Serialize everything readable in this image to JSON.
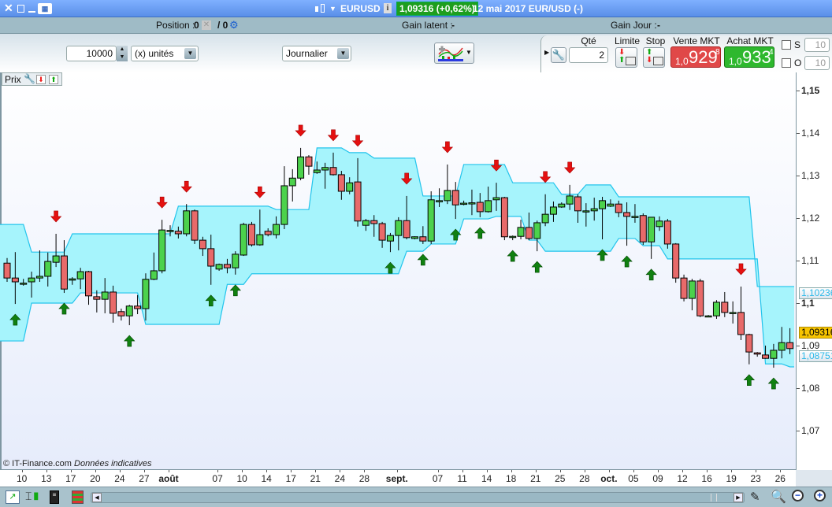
{
  "titlebar": {
    "symbol": "EURUSD",
    "price_badge": "1,09316 (+0,62%)",
    "date_info": "12 mai 2017 EUR/USD (-)",
    "badge_color": "#1e9e1e"
  },
  "infobar": {
    "position_label": "Position :",
    "position_value": "0",
    "position_slash": "/ 0",
    "gain_latent_label": "Gain latent :",
    "gain_latent_value": "-",
    "gain_jour_label": "Gain Jour :",
    "gain_jour_value": "-"
  },
  "toolbar": {
    "quantity": "10000",
    "unit": "(x) unités",
    "period": "Journalier"
  },
  "order_panel": {
    "qty_label": "Qté",
    "qty_value": "2",
    "limit_label": "Limite",
    "stop_label": "Stop",
    "sell_label": "Vente MKT",
    "sell_prefix": "1,0",
    "sell_big": "929",
    "sell_sup": "8",
    "buy_label": "Achat MKT",
    "buy_prefix": "1,0",
    "buy_big": "933",
    "buy_sup": "4",
    "s_label": "S",
    "s_value": "10",
    "o_label": "O",
    "o_value": "10",
    "sell_color": "#e04848",
    "buy_color": "#2eb82e"
  },
  "chart_header": {
    "label": "Prix"
  },
  "watermark": {
    "brand": "© IT-Finance.com",
    "note": "Données indicatives"
  },
  "chart_data": {
    "type": "candlestick",
    "ylim": [
      1.07,
      1.15
    ],
    "y_ticks": [
      {
        "v": 1.15,
        "label": "1,15",
        "bold": true
      },
      {
        "v": 1.14,
        "label": "1,14"
      },
      {
        "v": 1.13,
        "label": "1,13"
      },
      {
        "v": 1.12,
        "label": "1,12"
      },
      {
        "v": 1.11,
        "label": "1,11"
      },
      {
        "v": 1.1,
        "label": "1,1",
        "bold": true
      },
      {
        "v": 1.09,
        "label": "1,09"
      },
      {
        "v": 1.08,
        "label": "1,08"
      },
      {
        "v": 1.07,
        "label": "1,07"
      }
    ],
    "x_ticks": [
      "10",
      "13",
      "17",
      "20",
      "24",
      "27",
      "août",
      "07",
      "10",
      "14",
      "17",
      "21",
      "24",
      "28",
      "sept.",
      "07",
      "11",
      "14",
      "18",
      "21",
      "25",
      "28",
      "oct.",
      "05",
      "09",
      "12",
      "16",
      "19",
      "23",
      "26"
    ],
    "price_tags": [
      {
        "v": 1.10236,
        "label": "1,10236",
        "kind": "band"
      },
      {
        "v": 1.09316,
        "label": "1,09316",
        "kind": "last"
      },
      {
        "v": 1.08751,
        "label": "1,08751",
        "kind": "band"
      }
    ],
    "colors": {
      "up": "#4cd24c",
      "down": "#e86a6a",
      "band_fill": "#a6f4fc",
      "band_line": "#22c4ec",
      "sell_arrow": "#e41010",
      "buy_arrow": "#108010"
    },
    "ohlc": [
      [
        1.1094,
        1.1106,
        1.105,
        1.1059
      ],
      [
        1.1059,
        1.112,
        1.0998,
        1.105
      ],
      [
        1.1046,
        1.1057,
        1.1041,
        1.1047
      ],
      [
        1.105,
        1.1074,
        1.1013,
        1.1059
      ],
      [
        1.1059,
        1.1124,
        1.105,
        1.1063
      ],
      [
        1.1063,
        1.1119,
        1.1039,
        1.1098
      ],
      [
        1.1096,
        1.1163,
        1.1085,
        1.1111
      ],
      [
        1.1111,
        1.1148,
        1.1024,
        1.1033
      ],
      [
        1.1054,
        1.1061,
        1.1043,
        1.1057
      ],
      [
        1.1057,
        1.1083,
        1.1033,
        1.1074
      ],
      [
        1.1074,
        1.1076,
        1.0996,
        1.1017
      ],
      [
        1.1015,
        1.103,
        1.0978,
        1.1009
      ],
      [
        1.1009,
        1.1059,
        1.0976,
        1.1026
      ],
      [
        1.1026,
        1.1041,
        1.0954,
        1.0976
      ],
      [
        1.098,
        1.0987,
        1.0959,
        1.097
      ],
      [
        1.097,
        1.0996,
        1.0948,
        1.0993
      ],
      [
        1.0993,
        1.1019,
        1.0974,
        1.0987
      ],
      [
        1.0987,
        1.107,
        1.0959,
        1.1056
      ],
      [
        1.1056,
        1.1119,
        1.1054,
        1.1076
      ],
      [
        1.1076,
        1.1196,
        1.107,
        1.1172
      ],
      [
        1.117,
        1.1183,
        1.1157,
        1.1171
      ],
      [
        1.1169,
        1.118,
        1.1152,
        1.1163
      ],
      [
        1.1163,
        1.1233,
        1.1157,
        1.1217
      ],
      [
        1.1217,
        1.122,
        1.1139,
        1.1148
      ],
      [
        1.1148,
        1.1156,
        1.1111,
        1.1128
      ],
      [
        1.1128,
        1.1161,
        1.1043,
        1.1087
      ],
      [
        1.108,
        1.1093,
        1.1076,
        1.1091
      ],
      [
        1.1091,
        1.1104,
        1.107,
        1.1083
      ],
      [
        1.1083,
        1.1122,
        1.1067,
        1.1115
      ],
      [
        1.1113,
        1.1189,
        1.1111,
        1.1185
      ],
      [
        1.1185,
        1.1191,
        1.1133,
        1.1137
      ],
      [
        1.1137,
        1.122,
        1.1135,
        1.1161
      ],
      [
        1.1169,
        1.1176,
        1.1157,
        1.1161
      ],
      [
        1.1161,
        1.1204,
        1.1152,
        1.1185
      ],
      [
        1.1185,
        1.1322,
        1.1174,
        1.1276
      ],
      [
        1.1276,
        1.1315,
        1.1239,
        1.1294
      ],
      [
        1.1294,
        1.1365,
        1.1289,
        1.1344
      ],
      [
        1.1344,
        1.1348,
        1.1302,
        1.1322
      ],
      [
        1.1307,
        1.1333,
        1.1304,
        1.1313
      ],
      [
        1.1313,
        1.133,
        1.1269,
        1.1319
      ],
      [
        1.1319,
        1.1354,
        1.13,
        1.1302
      ],
      [
        1.1302,
        1.1311,
        1.1243,
        1.1263
      ],
      [
        1.1263,
        1.1296,
        1.1256,
        1.1283
      ],
      [
        1.1285,
        1.1341,
        1.118,
        1.1193
      ],
      [
        1.1183,
        1.1198,
        1.117,
        1.1194
      ],
      [
        1.1194,
        1.1207,
        1.1156,
        1.1187
      ],
      [
        1.1187,
        1.1191,
        1.113,
        1.1148
      ],
      [
        1.1146,
        1.1165,
        1.112,
        1.1159
      ],
      [
        1.1159,
        1.1202,
        1.1124,
        1.1194
      ],
      [
        1.1194,
        1.1252,
        1.115,
        1.1154
      ],
      [
        1.1152,
        1.1157,
        1.115,
        1.1156
      ],
      [
        1.1156,
        1.1181,
        1.1139,
        1.1146
      ],
      [
        1.1146,
        1.1263,
        1.1139,
        1.1243
      ],
      [
        1.1241,
        1.127,
        1.1226,
        1.1241
      ],
      [
        1.1241,
        1.1326,
        1.1233,
        1.1265
      ],
      [
        1.1265,
        1.1285,
        1.1198,
        1.1231
      ],
      [
        1.1235,
        1.1241,
        1.123,
        1.1235
      ],
      [
        1.1235,
        1.1267,
        1.1207,
        1.1236
      ],
      [
        1.1237,
        1.1259,
        1.1202,
        1.1215
      ],
      [
        1.1215,
        1.1274,
        1.1213,
        1.1241
      ],
      [
        1.1243,
        1.1283,
        1.1217,
        1.1248
      ],
      [
        1.1248,
        1.125,
        1.1148,
        1.1156
      ],
      [
        1.1157,
        1.1159,
        1.1148,
        1.1157
      ],
      [
        1.1157,
        1.1196,
        1.115,
        1.1178
      ],
      [
        1.1178,
        1.1213,
        1.1148,
        1.1152
      ],
      [
        1.1152,
        1.1194,
        1.1122,
        1.1189
      ],
      [
        1.1189,
        1.1256,
        1.1181,
        1.1209
      ],
      [
        1.1209,
        1.1239,
        1.1191,
        1.1226
      ],
      [
        1.1226,
        1.1237,
        1.1224,
        1.1233
      ],
      [
        1.1233,
        1.1278,
        1.1219,
        1.1252
      ],
      [
        1.125,
        1.1256,
        1.1189,
        1.1217
      ],
      [
        1.1217,
        1.1235,
        1.118,
        1.1217
      ],
      [
        1.1217,
        1.1248,
        1.1194,
        1.1222
      ],
      [
        1.1222,
        1.125,
        1.115,
        1.1241
      ],
      [
        1.1228,
        1.1244,
        1.1226,
        1.1233
      ],
      [
        1.1233,
        1.1241,
        1.1202,
        1.1213
      ],
      [
        1.1213,
        1.1237,
        1.1135,
        1.1204
      ],
      [
        1.1204,
        1.1233,
        1.1189,
        1.1204
      ],
      [
        1.1206,
        1.1211,
        1.1137,
        1.1144
      ],
      [
        1.1144,
        1.1202,
        1.1104,
        1.1202
      ],
      [
        1.118,
        1.1204,
        1.117,
        1.1193
      ],
      [
        1.1193,
        1.1198,
        1.1128,
        1.1139
      ],
      [
        1.1139,
        1.1141,
        1.1048,
        1.1059
      ],
      [
        1.1059,
        1.1067,
        1.1004,
        1.1011
      ],
      [
        1.1011,
        1.1057,
        1.0983,
        1.1052
      ],
      [
        1.1052,
        1.1057,
        1.0967,
        1.097
      ],
      [
        1.097,
        1.0972,
        1.0967,
        1.097
      ],
      [
        1.097,
        1.1007,
        1.0963,
        1.1002
      ],
      [
        1.1002,
        1.1026,
        1.0967,
        1.0978
      ],
      [
        1.0978,
        1.1004,
        1.0952,
        1.0978
      ],
      [
        1.0978,
        1.1039,
        1.0913,
        1.0926
      ],
      [
        1.0926,
        1.0928,
        1.0856,
        1.0885
      ],
      [
        1.0883,
        1.0885,
        1.0874,
        1.088
      ],
      [
        1.0878,
        1.09,
        1.0869,
        1.087
      ],
      [
        1.087,
        1.0904,
        1.0848,
        1.0889
      ],
      [
        1.0889,
        1.0944,
        1.087,
        1.0907
      ],
      [
        1.0907,
        1.0941,
        1.088,
        1.0893
      ]
    ],
    "band_upper": [
      1.1185,
      1.1185,
      1.1185,
      1.112,
      1.112,
      1.112,
      1.112,
      1.112,
      1.1163,
      1.1163,
      1.1163,
      1.1163,
      1.1163,
      1.1163,
      1.1163,
      1.1163,
      1.1163,
      1.1163,
      1.1163,
      1.1163,
      1.1163,
      1.1228,
      1.1228,
      1.1228,
      1.1228,
      1.1228,
      1.1228,
      1.1228,
      1.1228,
      1.1228,
      1.1228,
      1.1228,
      1.1228,
      1.122,
      1.122,
      1.122,
      1.122,
      1.122,
      1.1365,
      1.1365,
      1.1365,
      1.1365,
      1.1354,
      1.1354,
      1.1354,
      1.1341,
      1.1341,
      1.1341,
      1.1341,
      1.1341,
      1.1341,
      1.1252,
      1.1252,
      1.1252,
      1.1252,
      1.1252,
      1.1326,
      1.1326,
      1.1326,
      1.1326,
      1.1326,
      1.1326,
      1.1283,
      1.1283,
      1.1283,
      1.1283,
      1.1283,
      1.1283,
      1.1256,
      1.1256,
      1.1256,
      1.1278,
      1.1278,
      1.1278,
      1.1278,
      1.125,
      1.125,
      1.125,
      1.125,
      1.125,
      1.125,
      1.125,
      1.125,
      1.125,
      1.125,
      1.125,
      1.125,
      1.125,
      1.125,
      1.125,
      1.125,
      1.125,
      1.1039,
      1.1039,
      1.1039,
      1.1039,
      1.1039
    ],
    "band_lower": [
      1.0911,
      1.0911,
      1.0911,
      1.1,
      1.1,
      1.1,
      1.1,
      1.1,
      1.1,
      1.1024,
      1.1024,
      1.1024,
      1.1024,
      1.1024,
      1.1024,
      1.1024,
      1.1024,
      1.095,
      1.095,
      1.095,
      1.095,
      1.095,
      1.095,
      1.095,
      1.095,
      1.095,
      1.095,
      1.1044,
      1.1044,
      1.1044,
      1.1069,
      1.1069,
      1.1069,
      1.1069,
      1.1069,
      1.1069,
      1.1069,
      1.1069,
      1.1069,
      1.1069,
      1.1069,
      1.1069,
      1.1069,
      1.1069,
      1.1069,
      1.1069,
      1.1069,
      1.1069,
      1.1069,
      1.1122,
      1.1122,
      1.1122,
      1.1139,
      1.1139,
      1.1139,
      1.1139,
      1.1198,
      1.1198,
      1.1198,
      1.1198,
      1.1204,
      1.1204,
      1.1204,
      1.1204,
      1.1148,
      1.1148,
      1.1122,
      1.1122,
      1.1122,
      1.1122,
      1.1122,
      1.1122,
      1.1122,
      1.1122,
      1.1122,
      1.1152,
      1.1152,
      1.1152,
      1.1135,
      1.1135,
      1.1135,
      1.1104,
      1.1104,
      1.1104,
      1.1104,
      1.1104,
      1.1104,
      1.1104,
      1.1104,
      1.1104,
      1.1104,
      1.1104,
      1.1104,
      1.0857,
      1.0857,
      1.0857,
      1.085
    ],
    "sell_signals": [
      6,
      19,
      22,
      31,
      36,
      40,
      43,
      49,
      54,
      60,
      66,
      69,
      90
    ],
    "buy_signals": [
      1,
      7,
      15,
      25,
      28,
      47,
      51,
      55,
      58,
      62,
      65,
      73,
      76,
      79,
      91,
      94
    ]
  }
}
